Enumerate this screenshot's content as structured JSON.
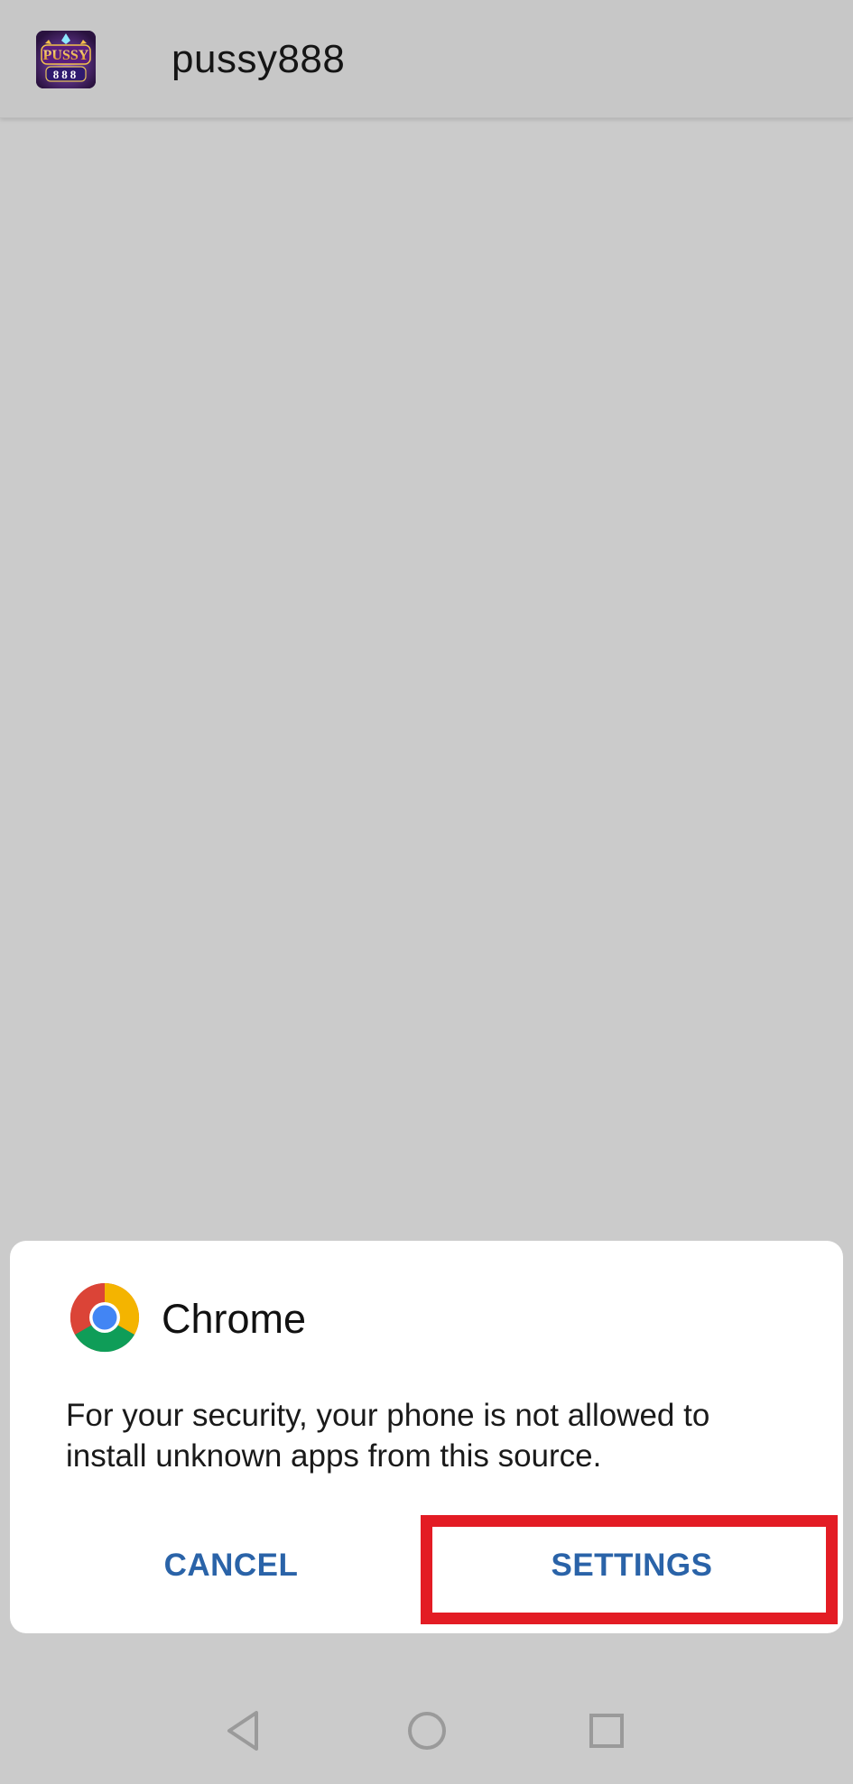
{
  "app": {
    "title": "pussy888",
    "icon": "pussy888-app-logo",
    "icon_text": {
      "top": "PUSSY",
      "bottom": "888"
    }
  },
  "dialog": {
    "source_app": "Chrome",
    "source_icon": "chrome-logo",
    "message": "For your security, your phone is not allowed to install unknown apps from this source.",
    "cancel_label": "CANCEL",
    "settings_label": "SETTINGS"
  },
  "navigation": {
    "back_icon": "back-triangle-icon",
    "home_icon": "home-circle-icon",
    "recents_icon": "recents-square-icon"
  },
  "colors": {
    "overlay": "#cbcbcb",
    "button_text": "#2a63a8",
    "highlight_border": "#e31c24",
    "dialog_bg": "#ffffff"
  }
}
